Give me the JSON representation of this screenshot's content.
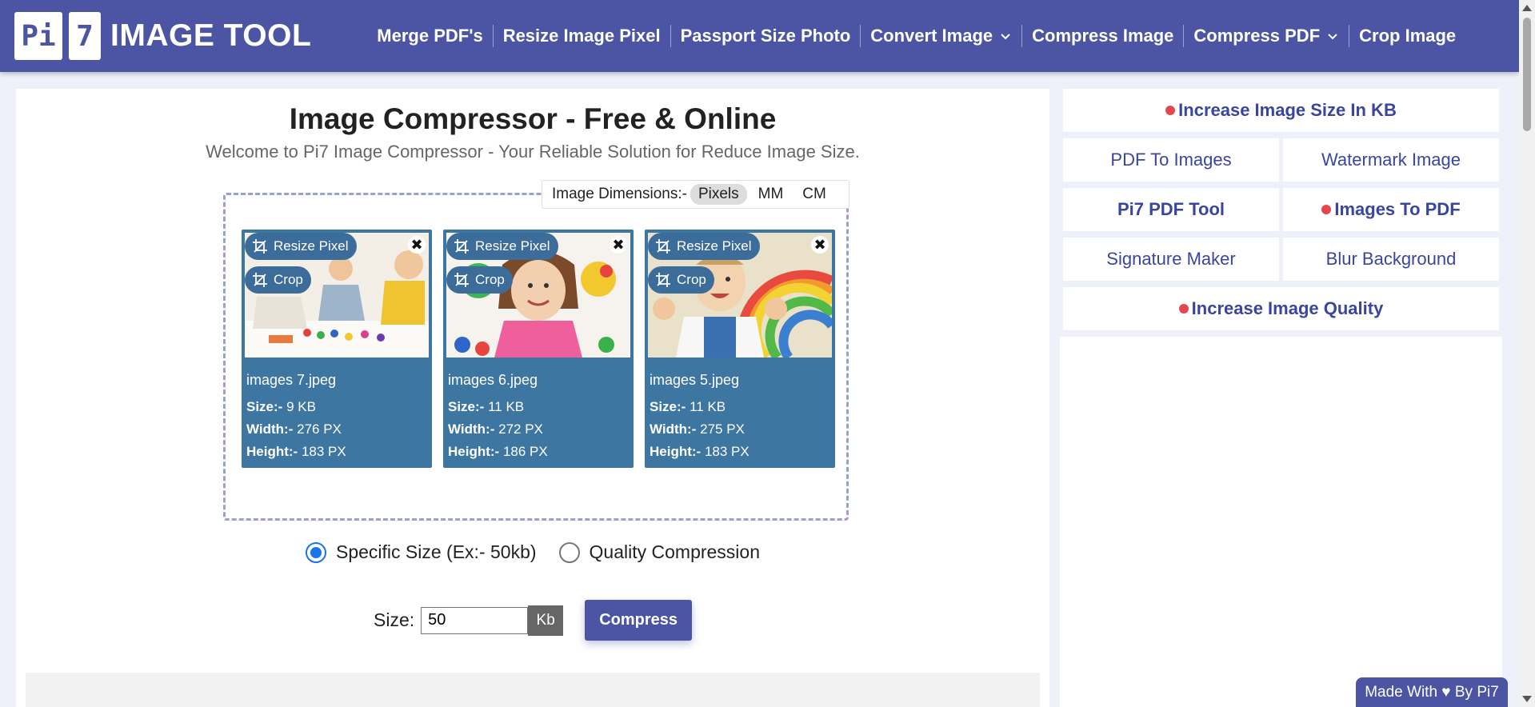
{
  "header": {
    "logo_pi": "Pi",
    "logo_seven": "7",
    "logo_text": "IMAGE TOOL",
    "nav": [
      {
        "label": "Merge PDF's",
        "has_dropdown": false
      },
      {
        "label": "Resize Image Pixel",
        "has_dropdown": false
      },
      {
        "label": "Passport Size Photo",
        "has_dropdown": false
      },
      {
        "label": "Convert Image",
        "has_dropdown": true
      },
      {
        "label": "Compress Image",
        "has_dropdown": false
      },
      {
        "label": "Compress PDF",
        "has_dropdown": true
      },
      {
        "label": "Crop Image",
        "has_dropdown": false
      }
    ]
  },
  "main": {
    "title": "Image Compressor - Free & Online",
    "subtitle": "Welcome to Pi7 Image Compressor - Your Reliable Solution for Reduce Image Size.",
    "dimensions": {
      "label": "Image Dimensions:-",
      "options": [
        "Pixels",
        "MM",
        "CM"
      ],
      "selected": "Pixels"
    },
    "card_actions": {
      "resize": "Resize Pixel",
      "crop": "Crop"
    },
    "meta_labels": {
      "size": "Size:-",
      "width": "Width:-",
      "height": "Height:-"
    },
    "images": [
      {
        "name": "images 7.jpeg",
        "size": "9 KB",
        "width": "276 PX",
        "height": "183 PX"
      },
      {
        "name": "images 6.jpeg",
        "size": "11 KB",
        "width": "272 PX",
        "height": "186 PX"
      },
      {
        "name": "images 5.jpeg",
        "size": "11 KB",
        "width": "275 PX",
        "height": "183 PX"
      }
    ],
    "mode_options": [
      {
        "label": "Specific Size (Ex:- 50kb)",
        "checked": true
      },
      {
        "label": "Quality Compression",
        "checked": false
      }
    ],
    "size_label": "Size:",
    "size_value": "50",
    "size_unit": "Kb",
    "compress_label": "Compress"
  },
  "sidebar": {
    "increase_kb": "Increase Image Size In KB",
    "pdf_to_images": "PDF To Images",
    "watermark": "Watermark Image",
    "pdf_tool": "Pi7 PDF Tool",
    "images_to_pdf": "Images To PDF",
    "signature": "Signature Maker",
    "blur": "Blur Background",
    "increase_quality": "Increase Image Quality"
  },
  "footer": {
    "credit": "Made With ♥ By  Pi7"
  },
  "colors": {
    "brand": "#4b55a4",
    "card": "#3e76a2",
    "accent_dot": "#e5474f",
    "radio_checked": "#1a73e8"
  }
}
